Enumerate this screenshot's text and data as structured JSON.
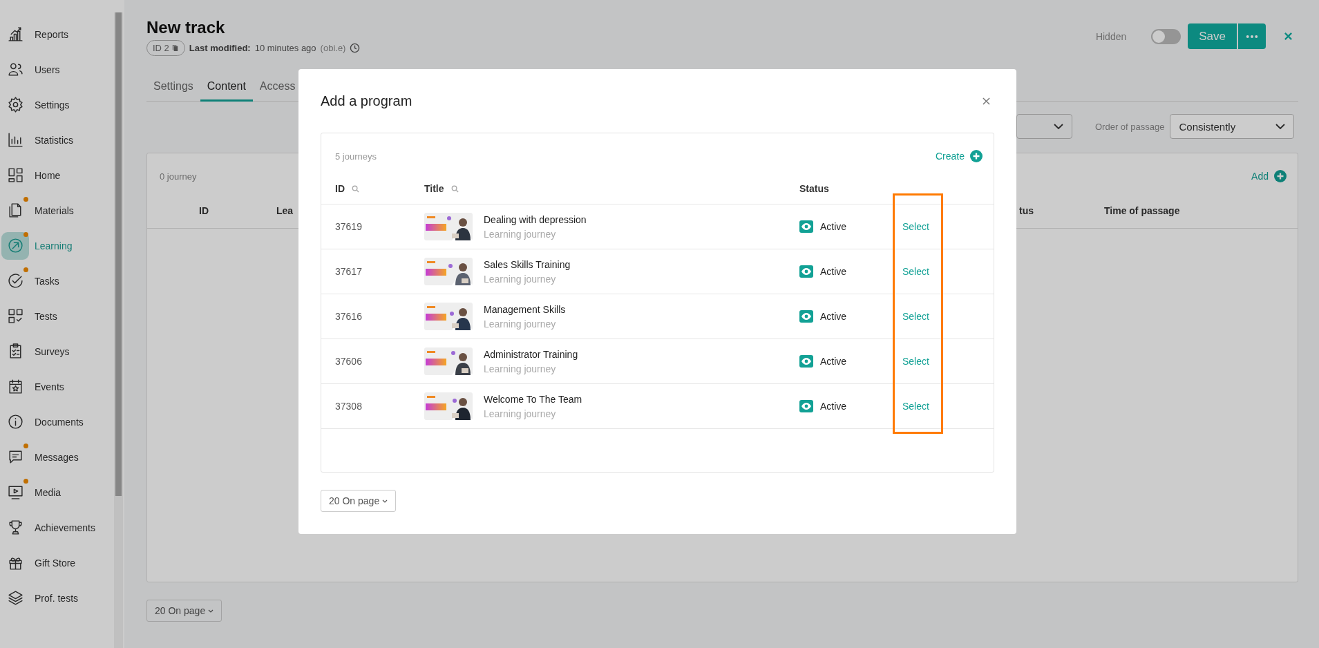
{
  "sidebar": {
    "items": [
      {
        "label": "Reports",
        "selected": false,
        "notification": false
      },
      {
        "label": "Users",
        "selected": false,
        "notification": false
      },
      {
        "label": "Settings",
        "selected": false,
        "notification": false
      },
      {
        "label": "Statistics",
        "selected": false,
        "notification": false
      },
      {
        "label": "Home",
        "selected": false,
        "notification": false
      },
      {
        "label": "Materials",
        "selected": false,
        "notification": true
      },
      {
        "label": "Learning",
        "selected": true,
        "notification": true
      },
      {
        "label": "Tasks",
        "selected": false,
        "notification": true
      },
      {
        "label": "Tests",
        "selected": false,
        "notification": false
      },
      {
        "label": "Surveys",
        "selected": false,
        "notification": false
      },
      {
        "label": "Events",
        "selected": false,
        "notification": false
      },
      {
        "label": "Documents",
        "selected": false,
        "notification": false
      },
      {
        "label": "Messages",
        "selected": false,
        "notification": true
      },
      {
        "label": "Media",
        "selected": false,
        "notification": true
      },
      {
        "label": "Achievements",
        "selected": false,
        "notification": false
      },
      {
        "label": "Gift Store",
        "selected": false,
        "notification": false
      },
      {
        "label": "Prof. tests",
        "selected": false,
        "notification": false
      }
    ]
  },
  "page": {
    "title": "New track",
    "id_badge": "ID 2",
    "modified_label": "Last modified:",
    "modified_value": "10 minutes ago",
    "modified_by": "(obi.e)",
    "visibility_label": "Hidden",
    "visibility_on": false,
    "save": "Save",
    "tabs": [
      {
        "label": "Settings",
        "selected": false
      },
      {
        "label": "Content",
        "selected": true
      },
      {
        "label": "Access",
        "selected": false
      }
    ],
    "order_label": "Order of passage",
    "order_value": "Consistently",
    "journey_count": "0 journey",
    "add": "Add",
    "columns": [
      "ID",
      "Lea",
      "tus",
      "Time of passage"
    ],
    "pager": "20 On page"
  },
  "modal": {
    "title": "Add a program",
    "count": "5 journeys",
    "create": "Create",
    "columns": [
      {
        "label": "ID",
        "searchable": true
      },
      {
        "label": "Title",
        "searchable": true
      },
      {
        "label": "Status",
        "searchable": false
      }
    ],
    "rows": [
      {
        "id": "37619",
        "title": "Dealing with depression",
        "subtitle": "Learning journey",
        "status": "Active",
        "action": "Select"
      },
      {
        "id": "37617",
        "title": "Sales Skills Training",
        "subtitle": "Learning journey",
        "status": "Active",
        "action": "Select"
      },
      {
        "id": "37616",
        "title": "Management Skills",
        "subtitle": "Learning journey",
        "status": "Active",
        "action": "Select"
      },
      {
        "id": "37606",
        "title": "Administrator Training",
        "subtitle": "Learning journey",
        "status": "Active",
        "action": "Select"
      },
      {
        "id": "37308",
        "title": "Welcome To The Team",
        "subtitle": "Learning journey",
        "status": "Active",
        "action": "Select"
      }
    ],
    "pager": "20 On page"
  }
}
